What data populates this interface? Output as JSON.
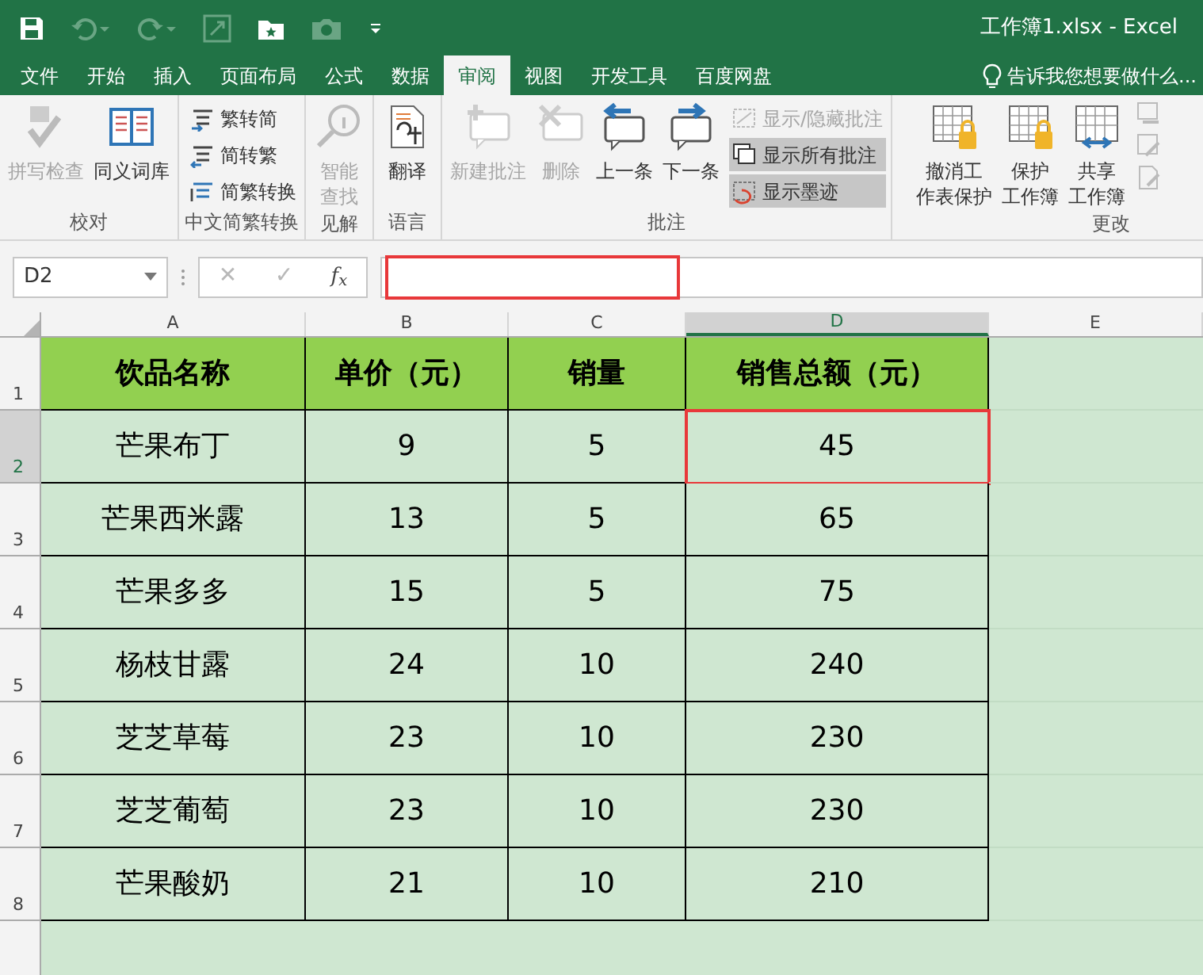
{
  "window": {
    "title": "工作簿1.xlsx - Excel"
  },
  "tabs": [
    {
      "label": "文件",
      "selected": false
    },
    {
      "label": "开始",
      "selected": false
    },
    {
      "label": "插入",
      "selected": false
    },
    {
      "label": "页面布局",
      "selected": false
    },
    {
      "label": "公式",
      "selected": false
    },
    {
      "label": "数据",
      "selected": false
    },
    {
      "label": "审阅",
      "selected": true
    },
    {
      "label": "视图",
      "selected": false
    },
    {
      "label": "开发工具",
      "selected": false
    },
    {
      "label": "百度网盘",
      "selected": false
    }
  ],
  "tell_me": {
    "placeholder": "告诉我您想要做什么..."
  },
  "ribbon": [
    {
      "name": "校对",
      "items": [
        {
          "kind": "large",
          "label": "拼写检查",
          "disabled": true
        },
        {
          "kind": "large",
          "label": "同义词库",
          "disabled": false
        }
      ]
    },
    {
      "name": "中文简繁转换",
      "items": [
        {
          "kind": "small",
          "label": "繁转简",
          "disabled": false,
          "selected": false
        },
        {
          "kind": "small",
          "label": "简转繁",
          "disabled": false,
          "selected": false
        },
        {
          "kind": "small",
          "label": "简繁转换",
          "disabled": false,
          "selected": false
        }
      ]
    },
    {
      "name": "见解",
      "items": [
        {
          "kind": "large",
          "lines": [
            "智能",
            "查找"
          ],
          "disabled": true
        }
      ]
    },
    {
      "name": "语言",
      "items": [
        {
          "kind": "large",
          "label": "翻译",
          "disabled": false
        }
      ]
    },
    {
      "name": "批注",
      "items": [
        {
          "kind": "large",
          "label": "新建批注",
          "disabled": true
        },
        {
          "kind": "large",
          "label": "删除",
          "disabled": true
        },
        {
          "kind": "large",
          "label": "上一条",
          "disabled": false
        },
        {
          "kind": "large",
          "label": "下一条",
          "disabled": false
        },
        {
          "kind": "small",
          "label": "显示/隐藏批注",
          "disabled": true,
          "selected": false
        },
        {
          "kind": "small",
          "label": "显示所有批注",
          "disabled": false,
          "selected": true
        },
        {
          "kind": "small",
          "label": "显示墨迹",
          "disabled": false,
          "selected": true
        }
      ]
    },
    {
      "name": "更改",
      "items": [
        {
          "kind": "large",
          "lines": [
            "撤消工",
            "作表保护"
          ],
          "disabled": false
        },
        {
          "kind": "large",
          "lines": [
            "保护",
            "工作簿"
          ],
          "disabled": false
        },
        {
          "kind": "large",
          "lines": [
            "共享",
            "工作簿"
          ],
          "disabled": false
        }
      ]
    }
  ],
  "formula_bar": {
    "name_box": "D2",
    "cancel": "✕",
    "enter": "✓",
    "function": "f$_{x}$"
  },
  "sheet": {
    "columns": [
      {
        "letter": "A",
        "selected": false
      },
      {
        "letter": "B",
        "selected": false
      },
      {
        "letter": "C",
        "selected": false
      },
      {
        "letter": "D",
        "selected": true
      },
      {
        "letter": "E",
        "selected": false
      }
    ],
    "rows": [
      {
        "number": "1",
        "selected": false,
        "cells": [
          "饮品名称",
          "单价（元）",
          "销量",
          "销售总额（元）"
        ]
      },
      {
        "number": "2",
        "selected": true,
        "cells": [
          "芒果布丁",
          "9",
          "5",
          "45"
        ]
      },
      {
        "number": "3",
        "selected": false,
        "cells": [
          "芒果西米露",
          "13",
          "5",
          "65"
        ]
      },
      {
        "number": "4",
        "selected": false,
        "cells": [
          "芒果多多",
          "15",
          "5",
          "75"
        ]
      },
      {
        "number": "5",
        "selected": false,
        "cells": [
          "杨枝甘露",
          "24",
          "10",
          "240"
        ]
      },
      {
        "number": "6",
        "selected": false,
        "cells": [
          "芝芝草莓",
          "23",
          "10",
          "230"
        ]
      },
      {
        "number": "7",
        "selected": false,
        "cells": [
          "芝芝葡萄",
          "23",
          "10",
          "230"
        ]
      },
      {
        "number": "8",
        "selected": false,
        "cells": [
          "芒果酸奶",
          "21",
          "10",
          "210"
        ]
      }
    ]
  }
}
